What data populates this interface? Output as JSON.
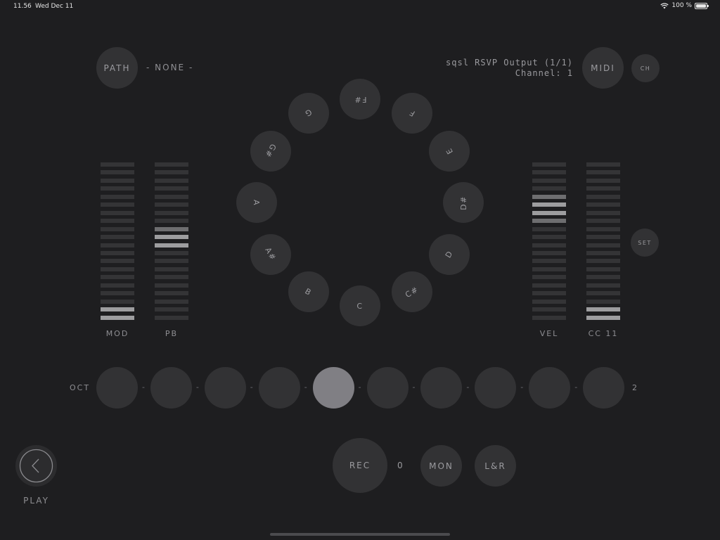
{
  "status": {
    "time": "11.56",
    "date": "Wed Dec 11",
    "battery": "100 %",
    "wifi_icon": "wifi-icon",
    "battery_icon": "battery-icon"
  },
  "path": {
    "button": "PATH",
    "value": "- NONE -"
  },
  "midi": {
    "output": "sqsl RSVP Output (1/1)",
    "channel": "Channel: 1",
    "button": "MIDI",
    "ch_button": "CH"
  },
  "set_button": "SET",
  "notes": [
    {
      "label": "F#"
    },
    {
      "label": "F"
    },
    {
      "label": "E"
    },
    {
      "label": "D#"
    },
    {
      "label": "D"
    },
    {
      "label": "C#"
    },
    {
      "label": "C"
    },
    {
      "label": "B"
    },
    {
      "label": "A#"
    },
    {
      "label": "A"
    },
    {
      "label": "G#"
    },
    {
      "label": "G"
    }
  ],
  "meters": [
    {
      "label": "MOD",
      "active": [
        0,
        1
      ],
      "dim": []
    },
    {
      "label": "PB",
      "active": [
        9,
        10
      ],
      "dim": [
        11
      ]
    },
    {
      "label": "VEL",
      "active": [
        14,
        13
      ],
      "dim": [
        12,
        15
      ]
    },
    {
      "label": "CC 11",
      "active": [
        0,
        1
      ],
      "dim": []
    }
  ],
  "octave": {
    "label": "OCT",
    "value": "2",
    "selected_index": 4,
    "count": 10
  },
  "bottom": {
    "rec": "REC",
    "rec_count": "0",
    "mon": "MON",
    "lr": "L&R"
  },
  "play": {
    "label": "PLAY",
    "icon": "chevron-left-icon"
  },
  "colors": {
    "background": "#1e1e20",
    "button": "#323234",
    "selected": "#807f84",
    "meter_on": "#9d9d9f"
  }
}
